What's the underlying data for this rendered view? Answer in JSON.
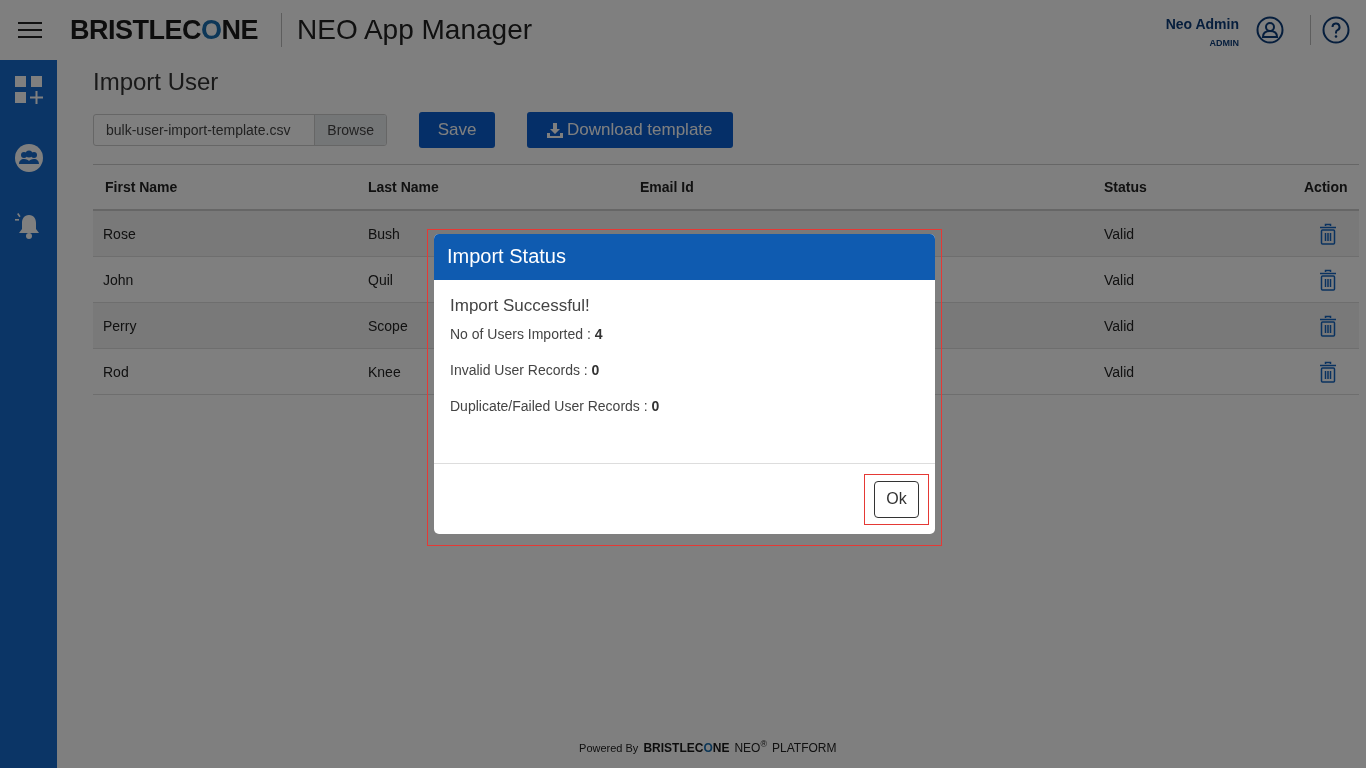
{
  "header": {
    "brand": "BRISTLECONE",
    "app_title": "NEO App Manager",
    "user_name": "Neo Admin",
    "user_role": "ADMIN"
  },
  "sidebar": {
    "items": [
      {
        "kind": "apps"
      },
      {
        "kind": "users"
      },
      {
        "kind": "alerts"
      }
    ]
  },
  "page": {
    "title": "Import User",
    "file_field": {
      "value": "bulk-user-import-template.csv",
      "button": "Browse"
    },
    "buttons": [
      {
        "label": "Save",
        "kind": "save"
      },
      {
        "label": "Download template",
        "kind": "download"
      }
    ]
  },
  "table": {
    "columns": [
      "First Name",
      "Last Name",
      "Email Id",
      "Status",
      "Action"
    ],
    "rows": [
      {
        "first_name": "Rose",
        "last_name": "Bush",
        "status": "Valid"
      },
      {
        "first_name": "John",
        "last_name": "Quil",
        "status": "Valid"
      },
      {
        "first_name": "Perry",
        "last_name": "Scope",
        "status": "Valid"
      },
      {
        "first_name": "Rod",
        "last_name": "Knee",
        "status": "Valid"
      }
    ]
  },
  "dialog": {
    "title": "Import Status",
    "heading": "Import Successful!",
    "lines": [
      "No of Users Imported : **4**",
      "Invalid User Records : **0**",
      "Duplicate/Failed User Records : **0**"
    ],
    "button": "Ok"
  },
  "footer": {
    "prefix": "Powered By",
    "brand": "BRISTLECONE",
    "product": "NEO$^{®}$",
    "suffix": "PLATFORM"
  }
}
